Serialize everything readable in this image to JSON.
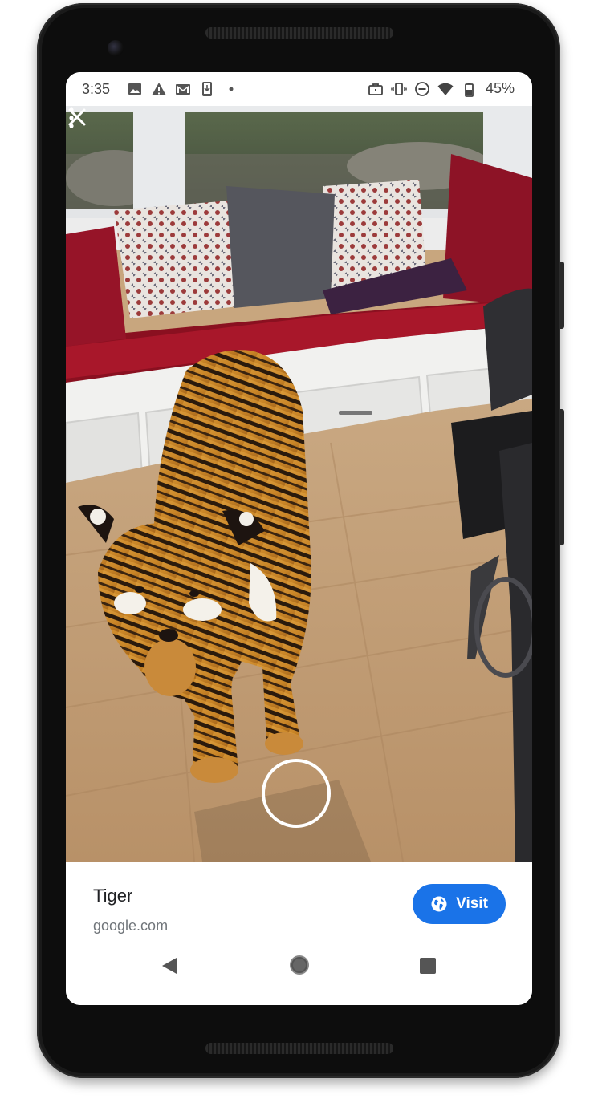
{
  "status_bar": {
    "time": "3:35",
    "battery_percent": "45%",
    "left_icons": [
      "image-icon",
      "warning-icon",
      "gmail-icon",
      "download-icon",
      "dot-icon"
    ],
    "right_icons": [
      "briefcase-icon",
      "vibrate-icon",
      "do-not-disturb-icon",
      "wifi-icon",
      "battery-icon"
    ]
  },
  "ar_viewer": {
    "close_icon": "close-icon",
    "menu_icon": "overflow-menu-icon",
    "subject": "tiger-3d-model",
    "placement_indicator": "placement-ring"
  },
  "sheet": {
    "title": "Tiger",
    "source": "google.com",
    "visit_label": "Visit",
    "visit_icon": "globe-icon",
    "accent": "#1a73e8"
  },
  "nav_bar": {
    "back_icon": "back-icon",
    "home_icon": "home-icon",
    "recents_icon": "recents-icon"
  }
}
